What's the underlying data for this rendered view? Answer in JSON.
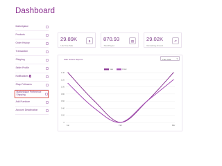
{
  "page": {
    "title": "Dashboard"
  },
  "sidebar": {
    "items": [
      {
        "label": "Marketplace"
      },
      {
        "label": "Products"
      },
      {
        "label": "Order History"
      },
      {
        "label": "Transaction"
      },
      {
        "label": "Shipping"
      },
      {
        "label": "Seller Profile"
      },
      {
        "label": "Notifications",
        "badge": "2"
      },
      {
        "label": "Shop Followers"
      },
      {
        "label": "Marketplace Preference Shipping",
        "active": true
      },
      {
        "label": "Add Furniture"
      },
      {
        "label": "Account Deactivation"
      }
    ]
  },
  "cards": [
    {
      "value": "29.89K",
      "label": "Life Time Sale",
      "icon": "dollar-icon",
      "glyph": "$"
    },
    {
      "value": "870.93",
      "label": "Total Payout",
      "icon": "document-icon",
      "glyph": "▤"
    },
    {
      "value": "29.02K",
      "label": "Remaining Amount",
      "icon": "refresh-icon",
      "glyph": "↶"
    }
  ],
  "chart_panel": {
    "title": "Sale Orders Reports",
    "range_select": "This Year"
  },
  "chart_data": {
    "type": "line",
    "x": [
      "Jan",
      "Feb",
      "Mar"
    ],
    "series": [
      {
        "name": "Sale",
        "color": "#8e3b96",
        "values": [
          1.4,
          0.6,
          0.0,
          0.6,
          1.4
        ]
      },
      {
        "name": "Order",
        "color": "#a64fb5",
        "values": [
          1.1,
          0.4,
          0.0,
          0.6,
          1.2
        ]
      }
    ],
    "ylim": [
      0,
      1.4
    ],
    "yticks": [
      "1.40",
      "1.20",
      "1.00",
      "0.80",
      "0.60",
      "0.40",
      "0.20",
      "0"
    ],
    "grid": true,
    "legend": "top-center"
  },
  "colors": {
    "accent": "#7b3a86",
    "active_border": "#d9534f"
  }
}
